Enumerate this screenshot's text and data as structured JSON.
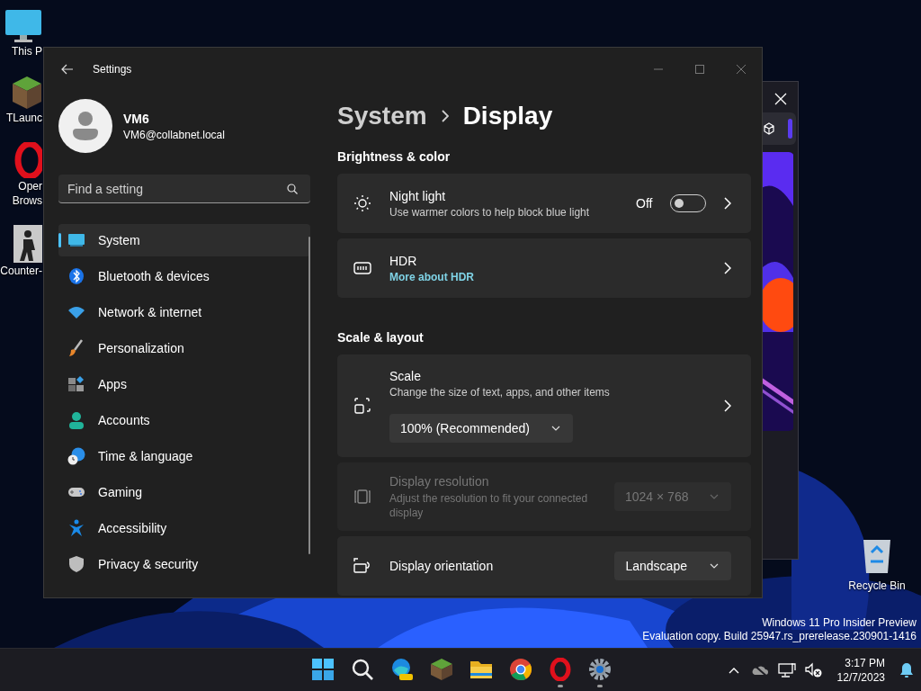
{
  "desktop_icons": [
    {
      "kind": "monitor",
      "lines": [
        "This P"
      ]
    },
    {
      "kind": "grass-block",
      "lines": [
        "TLaunc"
      ]
    },
    {
      "kind": "ring",
      "lines": [
        "Oper",
        "Brows"
      ]
    },
    {
      "kind": "soldier",
      "lines": [
        "Counter-"
      ]
    }
  ],
  "recycle_bin": {
    "label": "Recycle Bin"
  },
  "settings": {
    "title": "Settings",
    "user": {
      "name": "VM6",
      "email": "VM6@collabnet.local"
    },
    "search": {
      "placeholder": "Find a setting"
    },
    "nav": [
      {
        "label": "System",
        "selected": true
      },
      {
        "label": "Bluetooth & devices",
        "selected": false
      },
      {
        "label": "Network & internet",
        "selected": false
      },
      {
        "label": "Personalization",
        "selected": false
      },
      {
        "label": "Apps",
        "selected": false
      },
      {
        "label": "Accounts",
        "selected": false
      },
      {
        "label": "Time & language",
        "selected": false
      },
      {
        "label": "Gaming",
        "selected": false
      },
      {
        "label": "Accessibility",
        "selected": false
      },
      {
        "label": "Privacy & security",
        "selected": false
      }
    ],
    "breadcrumb": {
      "parent": "System",
      "current": "Display"
    },
    "sections": [
      {
        "title": "Brightness & color",
        "cards": [
          {
            "kind": "toggle",
            "title": "Night light",
            "subtitle": "Use warmer colors to help block blue light",
            "state_label": "Off",
            "on": false,
            "disabled": false
          },
          {
            "kind": "link",
            "title": "HDR",
            "link": "More about HDR",
            "disabled": false
          }
        ]
      },
      {
        "title": "Scale & layout",
        "cards": [
          {
            "kind": "dropdown-below",
            "title": "Scale",
            "subtitle": "Change the size of text, apps, and other items",
            "value": "100% (Recommended)",
            "disabled": false
          },
          {
            "kind": "dropdown",
            "title": "Display resolution",
            "subtitle": "Adjust the resolution to fit your connected display",
            "value": "1024 × 768",
            "disabled": true
          },
          {
            "kind": "dropdown",
            "title": "Display orientation",
            "value": "Landscape",
            "disabled": false
          }
        ]
      }
    ]
  },
  "os_notice": {
    "lines": [
      "Windows 11 Pro Insider Preview",
      "Evaluation copy. Build 25947.rs_prerelease.230901-1416"
    ]
  },
  "taskbar": {
    "apps": [
      {
        "kind": "start",
        "running": false
      },
      {
        "kind": "search",
        "running": false
      },
      {
        "kind": "edge",
        "running": false
      },
      {
        "kind": "grass-block",
        "running": false
      },
      {
        "kind": "folder",
        "running": false
      },
      {
        "kind": "chrome",
        "running": false
      },
      {
        "kind": "ring",
        "running": true
      },
      {
        "kind": "gear",
        "running": true
      }
    ],
    "time": "3:17 PM",
    "date": "12/7/2023"
  }
}
